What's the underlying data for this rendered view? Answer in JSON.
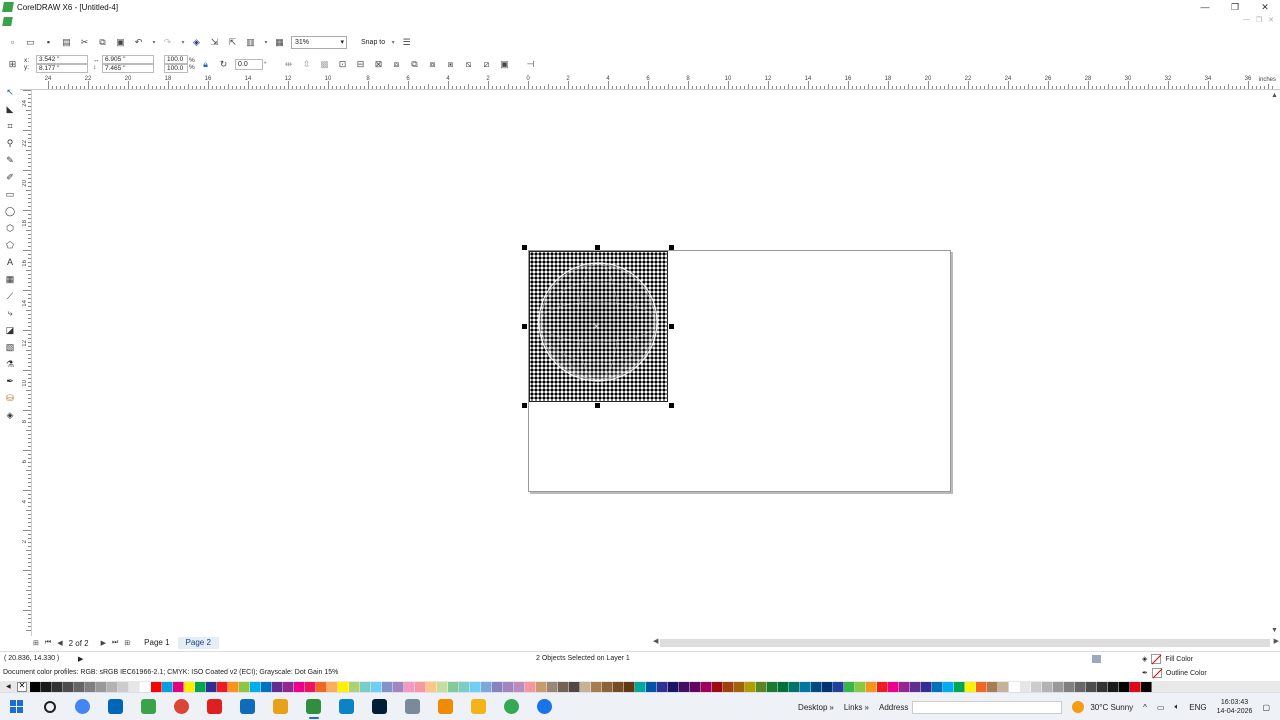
{
  "window": {
    "title": "CorelDRAW X6 - [Untitled-4]",
    "controls": [
      "—",
      "❐",
      "✕"
    ]
  },
  "toolbar": {
    "zoom": "31%",
    "snap_to": "Snap to"
  },
  "propbar": {
    "x": "3.542 \"",
    "y": "8.177 \"",
    "width": "6.905 \"",
    "height": "7.465 \"",
    "scale_x": "100.0",
    "scale_y": "100.0",
    "pct": "%",
    "angle": "0.0",
    "deg": "°",
    "x_label": "x:",
    "y_label": "y:"
  },
  "ruler": {
    "units": "inches",
    "h_labels": [
      "24",
      "22",
      "20",
      "18",
      "16",
      "14",
      "12",
      "10",
      "8",
      "6",
      "4",
      "2",
      "0",
      "2",
      "4",
      "6",
      "8",
      "10",
      "12",
      "14",
      "16",
      "18",
      "20",
      "22",
      "24",
      "26",
      "28",
      "30",
      "32",
      "34",
      "36"
    ],
    "v_labels": [
      "24",
      "22",
      "20",
      "18",
      "16",
      "14",
      "12",
      "10",
      "8",
      "6",
      "4",
      "2"
    ]
  },
  "pages": {
    "count": "2 of 2",
    "tabs": [
      "Page 1",
      "Page 2"
    ],
    "active": "Page 2"
  },
  "status": {
    "coords": "( 20.836, 14.330 )",
    "selection": "2 Objects Selected on Layer 1",
    "profiles": "Document color profiles: RGB: sRGB IEC61966-2.1; CMYK: ISO Coated v2 (ECI); Grayscale: Dot Gain 15%",
    "fill_label": "Fill Color",
    "outline_label": "Outline Color"
  },
  "palette": [
    "#000000",
    "#1a1a1a",
    "#333333",
    "#4d4d4d",
    "#666666",
    "#808080",
    "#999999",
    "#b3b3b3",
    "#cccccc",
    "#e6e6e6",
    "#ffffff",
    "#ff0000",
    "#00a0e3",
    "#e6007e",
    "#ffed00",
    "#00a651",
    "#2e3192",
    "#ed1c24",
    "#f7941d",
    "#8dc63f",
    "#00aeef",
    "#0072bc",
    "#662d91",
    "#92278f",
    "#ec008c",
    "#ed145b",
    "#f26522",
    "#fbaf5d",
    "#fff200",
    "#acd373",
    "#7accc8",
    "#6dcff6",
    "#8393ca",
    "#a186be",
    "#f49ac2",
    "#f6989d",
    "#fdc689",
    "#c4df9b",
    "#82ca9c",
    "#7bcdc8",
    "#6dcff6",
    "#7da7d9",
    "#8882be",
    "#a186be",
    "#bd8cbf",
    "#f5989d",
    "#c69c6d",
    "#998675",
    "#736357",
    "#534741",
    "#c7b299",
    "#a67c52",
    "#8c6239",
    "#754c24",
    "#603913",
    "#00a99d",
    "#0054a6",
    "#2e3192",
    "#1b1464",
    "#440e62",
    "#630460",
    "#9e005d",
    "#9e0b0f",
    "#a0410d",
    "#a3620a",
    "#aba000",
    "#598527",
    "#197b30",
    "#007236",
    "#00746b",
    "#0076a3",
    "#004a80",
    "#003471",
    "#21409a",
    "#39b54a",
    "#8dc63f",
    "#f7941d",
    "#ed1c24",
    "#ec008c",
    "#92278f",
    "#662d91",
    "#2e3192",
    "#0072bc",
    "#00aeef",
    "#00a651",
    "#fff200",
    "#f26522",
    "#a67c52",
    "#c7b299",
    "#ffffff",
    "#e6e6e6",
    "#cccccc",
    "#b3b3b3",
    "#999999",
    "#808080",
    "#666666",
    "#4d4d4d",
    "#333333",
    "#1a1a1a",
    "#000000",
    "#e30613",
    "#000000"
  ],
  "taskbar": {
    "desktop": "Desktop",
    "links": "Links",
    "address": "Address",
    "weather": "30°C  Sunny",
    "lang": "ENG",
    "time": "16:03:43",
    "date": "14-04-2026",
    "apps": [
      {
        "name": "search-icon",
        "color": "#222222"
      },
      {
        "name": "chrome-icon",
        "color": "#4285f4"
      },
      {
        "name": "store-icon",
        "color": "#0067b8"
      },
      {
        "name": "corel-icon",
        "color": "#3aa34a"
      },
      {
        "name": "chrome-icon",
        "color": "#db4437"
      },
      {
        "name": "acrobat-icon",
        "color": "#e02020"
      },
      {
        "name": "outlook-icon",
        "color": "#0f6cbd"
      },
      {
        "name": "folder-icon",
        "color": "#e8a21a"
      },
      {
        "name": "coreldraw-icon",
        "color": "#2f8f3e"
      },
      {
        "name": "edge-icon",
        "color": "#0b84c6"
      },
      {
        "name": "photoshop-icon",
        "color": "#001e36"
      },
      {
        "name": "app-icon",
        "color": "#7a8a9a"
      },
      {
        "name": "vlc-icon",
        "color": "#f08a00"
      },
      {
        "name": "folder-icon",
        "color": "#f2b418"
      },
      {
        "name": "chrome-icon",
        "color": "#34a853"
      },
      {
        "name": "chrome-icon",
        "color": "#1a73e8"
      }
    ]
  }
}
